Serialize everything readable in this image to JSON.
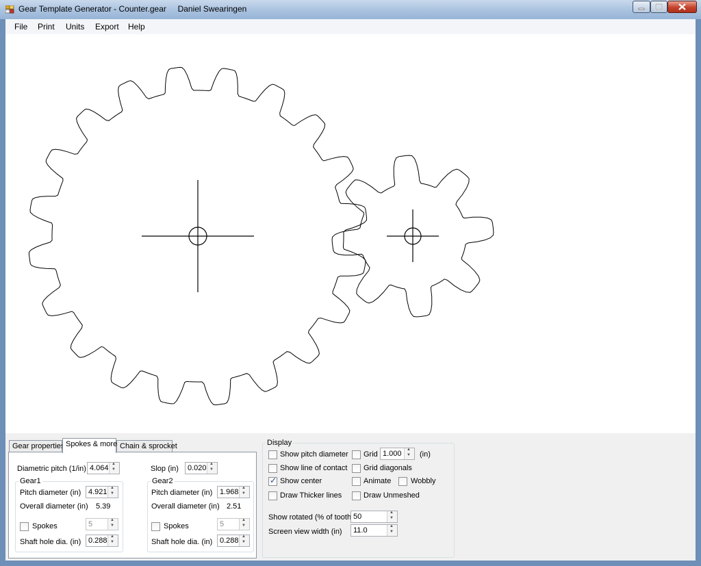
{
  "window": {
    "title": "Gear Template Generator - Counter.gear",
    "author": "Daniel Swearingen"
  },
  "menu": [
    "File",
    "Print",
    "Units",
    "Export",
    "Help"
  ],
  "icons": {
    "app": "gear-app-icon",
    "minimize": "minimize-icon",
    "maximize": "maximize-icon",
    "close": "close-icon"
  },
  "tabs": [
    "Gear properties",
    "Spokes & more",
    "Chain & sprocket"
  ],
  "active_tab": "Spokes & more",
  "spokes": {
    "diametric_pitch_label": "Diametric pitch  (1/in)",
    "diametric_pitch": "4.064",
    "slop_label": "Slop (in)",
    "slop": "0.020",
    "gear1": {
      "title": "Gear1",
      "pitch_label": "Pitch diameter (in)",
      "pitch": "4.921",
      "overall_label": "Overall diameter (in)",
      "overall": "5.39",
      "spokes_label": "Spokes",
      "spokes": "5",
      "shaft_label": "Shaft hole dia. (in)",
      "shaft": "0.288"
    },
    "gear2": {
      "title": "Gear2",
      "pitch_label": "Pitch diameter (in)",
      "pitch": "1.968",
      "overall_label": "Overall diameter (in)",
      "overall": "2.51",
      "spokes_label": "Spokes",
      "spokes": "5",
      "shaft_label": "Shaft hole dia. (in)",
      "shaft": "0.288"
    }
  },
  "display": {
    "title": "Display",
    "show_pitch": "Show pitch diameter",
    "show_line": "Show line of contact",
    "show_center": "Show center",
    "thicker": "Draw Thicker lines",
    "grid": "Grid",
    "grid_value": "1.000",
    "grid_unit": "(in)",
    "grid_diagonals": "Grid diagonals",
    "animate": "Animate",
    "wobbly": "Wobbly",
    "unmeshed": "Draw Unmeshed",
    "rotated_label": "Show rotated (% of tooth)",
    "rotated": "50",
    "width_label": "Screen view width (in)",
    "width": "11.0",
    "checked": {
      "show_center": true
    }
  },
  "gears": [
    {
      "name": "Gear1",
      "teeth": 20
    },
    {
      "name": "Gear2",
      "teeth": 8
    }
  ]
}
